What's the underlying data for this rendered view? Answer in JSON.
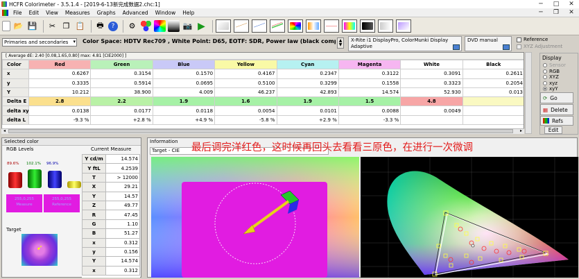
{
  "window": {
    "title": "HCFR Colorimeter - 3.5.1.4 - [2019-6-13新完成数据2.chc:1]",
    "min": "─",
    "max": "□",
    "close": "✕"
  },
  "menu": [
    "File",
    "Edit",
    "View",
    "Measures",
    "Graphs",
    "Advanced",
    "Window",
    "Help"
  ],
  "mdi_controls": {
    "min": "─",
    "restore": "❐",
    "close": "✕"
  },
  "infobar": {
    "mode": "Primaries and secondaries",
    "colorspace": "Color Space: HDTV Rec709 , White Point: D65, EOTF:  SDR, Power law (black compen...",
    "sensor": "X-Rite i1 DisplayPro, ColorMunki Display",
    "sensor_mode": "Adaptive",
    "generator": "DVD manual",
    "reference_label": "Reference",
    "xyz_adjust_label": "XYZ Adjustment"
  },
  "grid": {
    "summary": "[ Average dE: 2.40 [0.08,1.65,0.80]  max: 4.81 [CIE2000] ]",
    "columns": [
      "Color",
      "Red",
      "Green",
      "Blue",
      "Yellow",
      "Cyan",
      "Magenta",
      "White",
      "Black"
    ],
    "header_colors": [
      "#ecebe7",
      "#f7b2b2",
      "#b9f1b9",
      "#c9c9f7",
      "#f9f9a6",
      "#b6f1f1",
      "#f6b6f1",
      "#ffffff",
      "#ffffff"
    ],
    "rows": [
      {
        "label": "x",
        "values": [
          "0.6267",
          "0.3154",
          "0.1570",
          "0.4167",
          "0.2347",
          "0.3122",
          "0.3091",
          "0.2611"
        ]
      },
      {
        "label": "y",
        "values": [
          "0.3335",
          "0.5914",
          "0.0695",
          "0.5100",
          "0.3299",
          "0.1558",
          "0.3323",
          "0.2054"
        ]
      },
      {
        "label": "Y",
        "values": [
          "10.212",
          "38.900",
          "4.009",
          "46.237",
          "42.893",
          "14.574",
          "52.930",
          "0.013"
        ]
      },
      {
        "label": "Delta E",
        "values": [
          "2.8",
          "2.2",
          "1.9",
          "1.6",
          "1.9",
          "1.5",
          "4.8",
          ""
        ],
        "highlight": true
      },
      {
        "label": "delta xy",
        "values": [
          "0.0138",
          "0.0177",
          "0.0118",
          "0.0054",
          "0.0101",
          "0.0088",
          "0.0049",
          ""
        ]
      },
      {
        "label": "delta L",
        "values": [
          "-9.3 %",
          "+2.8 %",
          "+4.9 %",
          "-5.8 %",
          "+2.9 %",
          "-3.3 %",
          "",
          ""
        ]
      }
    ],
    "delta_e_colors": [
      "#fbe08e",
      "#b9f1a6",
      "#a6f1a6",
      "#a6f1a6",
      "#a6f1a6",
      "#a6f1a6",
      "#f7a6a6",
      "#faf9c2"
    ]
  },
  "display_panel": {
    "title": "Display",
    "options": [
      "Sensor",
      "RGB",
      "XYZ",
      "xyz",
      "xyY"
    ],
    "selected": "xyY",
    "go": "Go",
    "delete": "Delete",
    "refs": "Refs",
    "edit": "Edit"
  },
  "selected_color": {
    "title": "Selected color",
    "rgb_levels": "RGB Levels",
    "current_measure": "Current Measure",
    "bar_labels": [
      "89.6%",
      "102.1%",
      "96.9%"
    ],
    "bar_levels": [
      0.896,
      1.021,
      0.969
    ],
    "swatch_measure": "255,0,255 Measure",
    "swatch_reference": "255,0,255 Reference",
    "target_label": "Target",
    "measure_rows": [
      {
        "k": "Y cd/m",
        "v": "14.574"
      },
      {
        "k": "Y ftL",
        "v": "4.2539"
      },
      {
        "k": "T",
        "v": "> 12000"
      },
      {
        "k": "X",
        "v": "29.21"
      },
      {
        "k": "Y",
        "v": "14.57"
      },
      {
        "k": "Z",
        "v": "49.77"
      },
      {
        "k": "R",
        "v": "47.45"
      },
      {
        "k": "G",
        "v": "1.10"
      },
      {
        "k": "B",
        "v": "51.27"
      },
      {
        "k": "x",
        "v": "0.312"
      },
      {
        "k": "y",
        "v": "0.156"
      },
      {
        "k": "Y",
        "v": "14.574"
      },
      {
        "k": "x",
        "v": "0.312"
      }
    ]
  },
  "information": {
    "title": "Information",
    "target": "Target - CIE",
    "overlay": "最后调完洋红色，这时候再回头去看看三原色，在进行一次微调",
    "overlay_color": "#e21a1a"
  },
  "colors": {
    "magenta": "#e11ce1",
    "accent": "#e21a1a"
  }
}
